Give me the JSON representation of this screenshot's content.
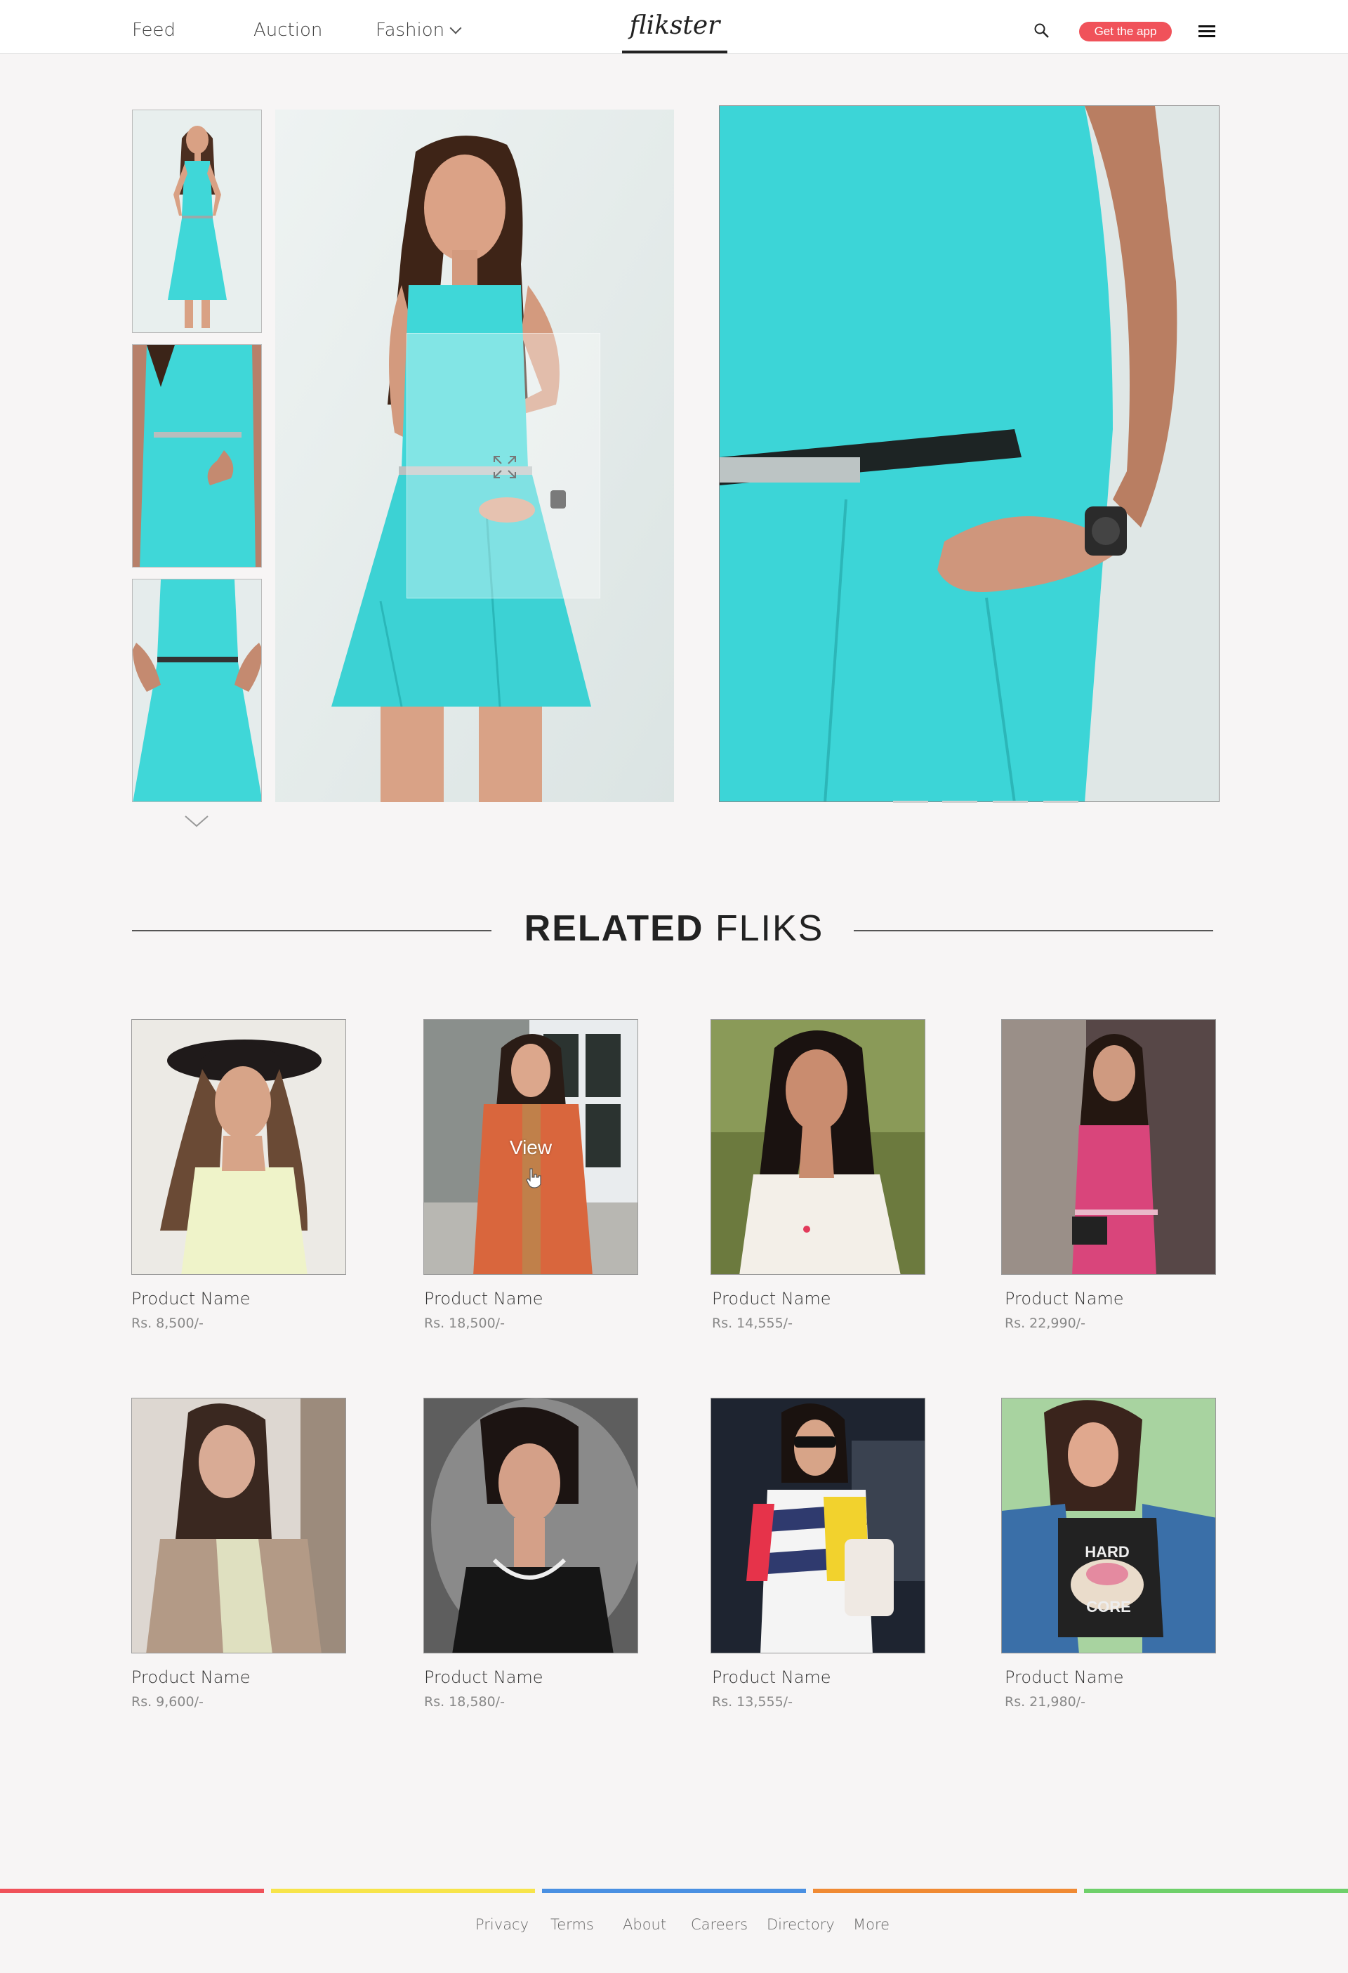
{
  "header": {
    "nav": [
      {
        "label": "Feed"
      },
      {
        "label": "Auction"
      },
      {
        "label": "Fashion"
      }
    ],
    "logo": "flikster",
    "get_app_label": "Get the app",
    "accent_color": "#f0525a"
  },
  "gallery": {
    "dress_color": "#3fd7d8",
    "thumbnails": [
      "thumb-full-body",
      "thumb-waist-front",
      "thumb-skirt-detail"
    ]
  },
  "related": {
    "title_bold": "RELATED",
    "title_light": "FLIKS",
    "hover_label": "View",
    "products": [
      {
        "name": "Product Name",
        "price": "Rs. 8,500/-"
      },
      {
        "name": "Product Name",
        "price": "Rs. 18,500/-"
      },
      {
        "name": "Product Name",
        "price": "Rs. 14,555/-"
      },
      {
        "name": "Product Name",
        "price": "Rs. 22,990/-"
      },
      {
        "name": "Product Name",
        "price": "Rs. 9,600/-"
      },
      {
        "name": "Product Name",
        "price": "Rs. 18,580/-"
      },
      {
        "name": "Product Name",
        "price": "Rs. 13,555/-"
      },
      {
        "name": "Product Name",
        "price": "Rs. 21,980/-"
      }
    ]
  },
  "footer": {
    "stripe_colors": [
      "#f0525a",
      "#f7e44a",
      "#4a90e2",
      "#f08a33",
      "#6fd06a"
    ],
    "links": [
      "Privacy",
      "Terms",
      "About",
      "Careers",
      "Directory",
      "More"
    ]
  }
}
